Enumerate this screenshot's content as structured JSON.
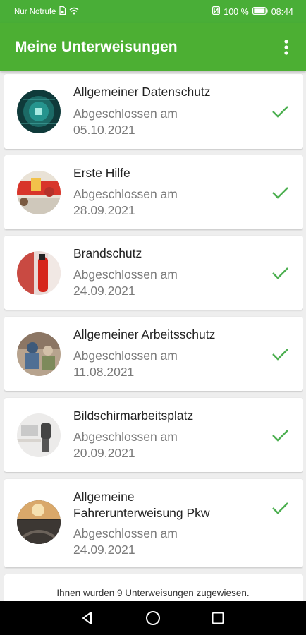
{
  "status_bar": {
    "carrier": "Nur Notrufe",
    "battery": "100 %",
    "time": "08:44"
  },
  "app_bar": {
    "title": "Meine Unterweisungen",
    "menu_icon": "more-vert-icon"
  },
  "items": [
    {
      "title": "Allgemeiner Datenschutz",
      "status": "Abgeschlossen am",
      "date": "05.10.2021",
      "icon": "check-icon"
    },
    {
      "title": "Erste Hilfe",
      "status": "Abgeschlossen am",
      "date": "28.09.2021",
      "icon": "check-icon"
    },
    {
      "title": "Brandschutz",
      "status": "Abgeschlossen am",
      "date": "24.09.2021",
      "icon": "check-icon"
    },
    {
      "title": "Allgemeiner Arbeitsschutz",
      "status": "Abgeschlossen am",
      "date": "11.08.2021",
      "icon": "check-icon"
    },
    {
      "title": "Bildschirmarbeitsplatz",
      "status": "Abgeschlossen am",
      "date": "20.09.2021",
      "icon": "check-icon"
    },
    {
      "title_line1": "Allgemeine",
      "title_line2": "Fahrerunterweisung Pkw",
      "status": "Abgeschlossen am",
      "date": "24.09.2021",
      "icon": "check-icon"
    }
  ],
  "footer": {
    "text": "Ihnen wurden 9 Unterweisungen zugewiesen."
  },
  "colors": {
    "primary": "#4caf33",
    "status_bar": "#49ae37",
    "check": "#4caf50"
  }
}
